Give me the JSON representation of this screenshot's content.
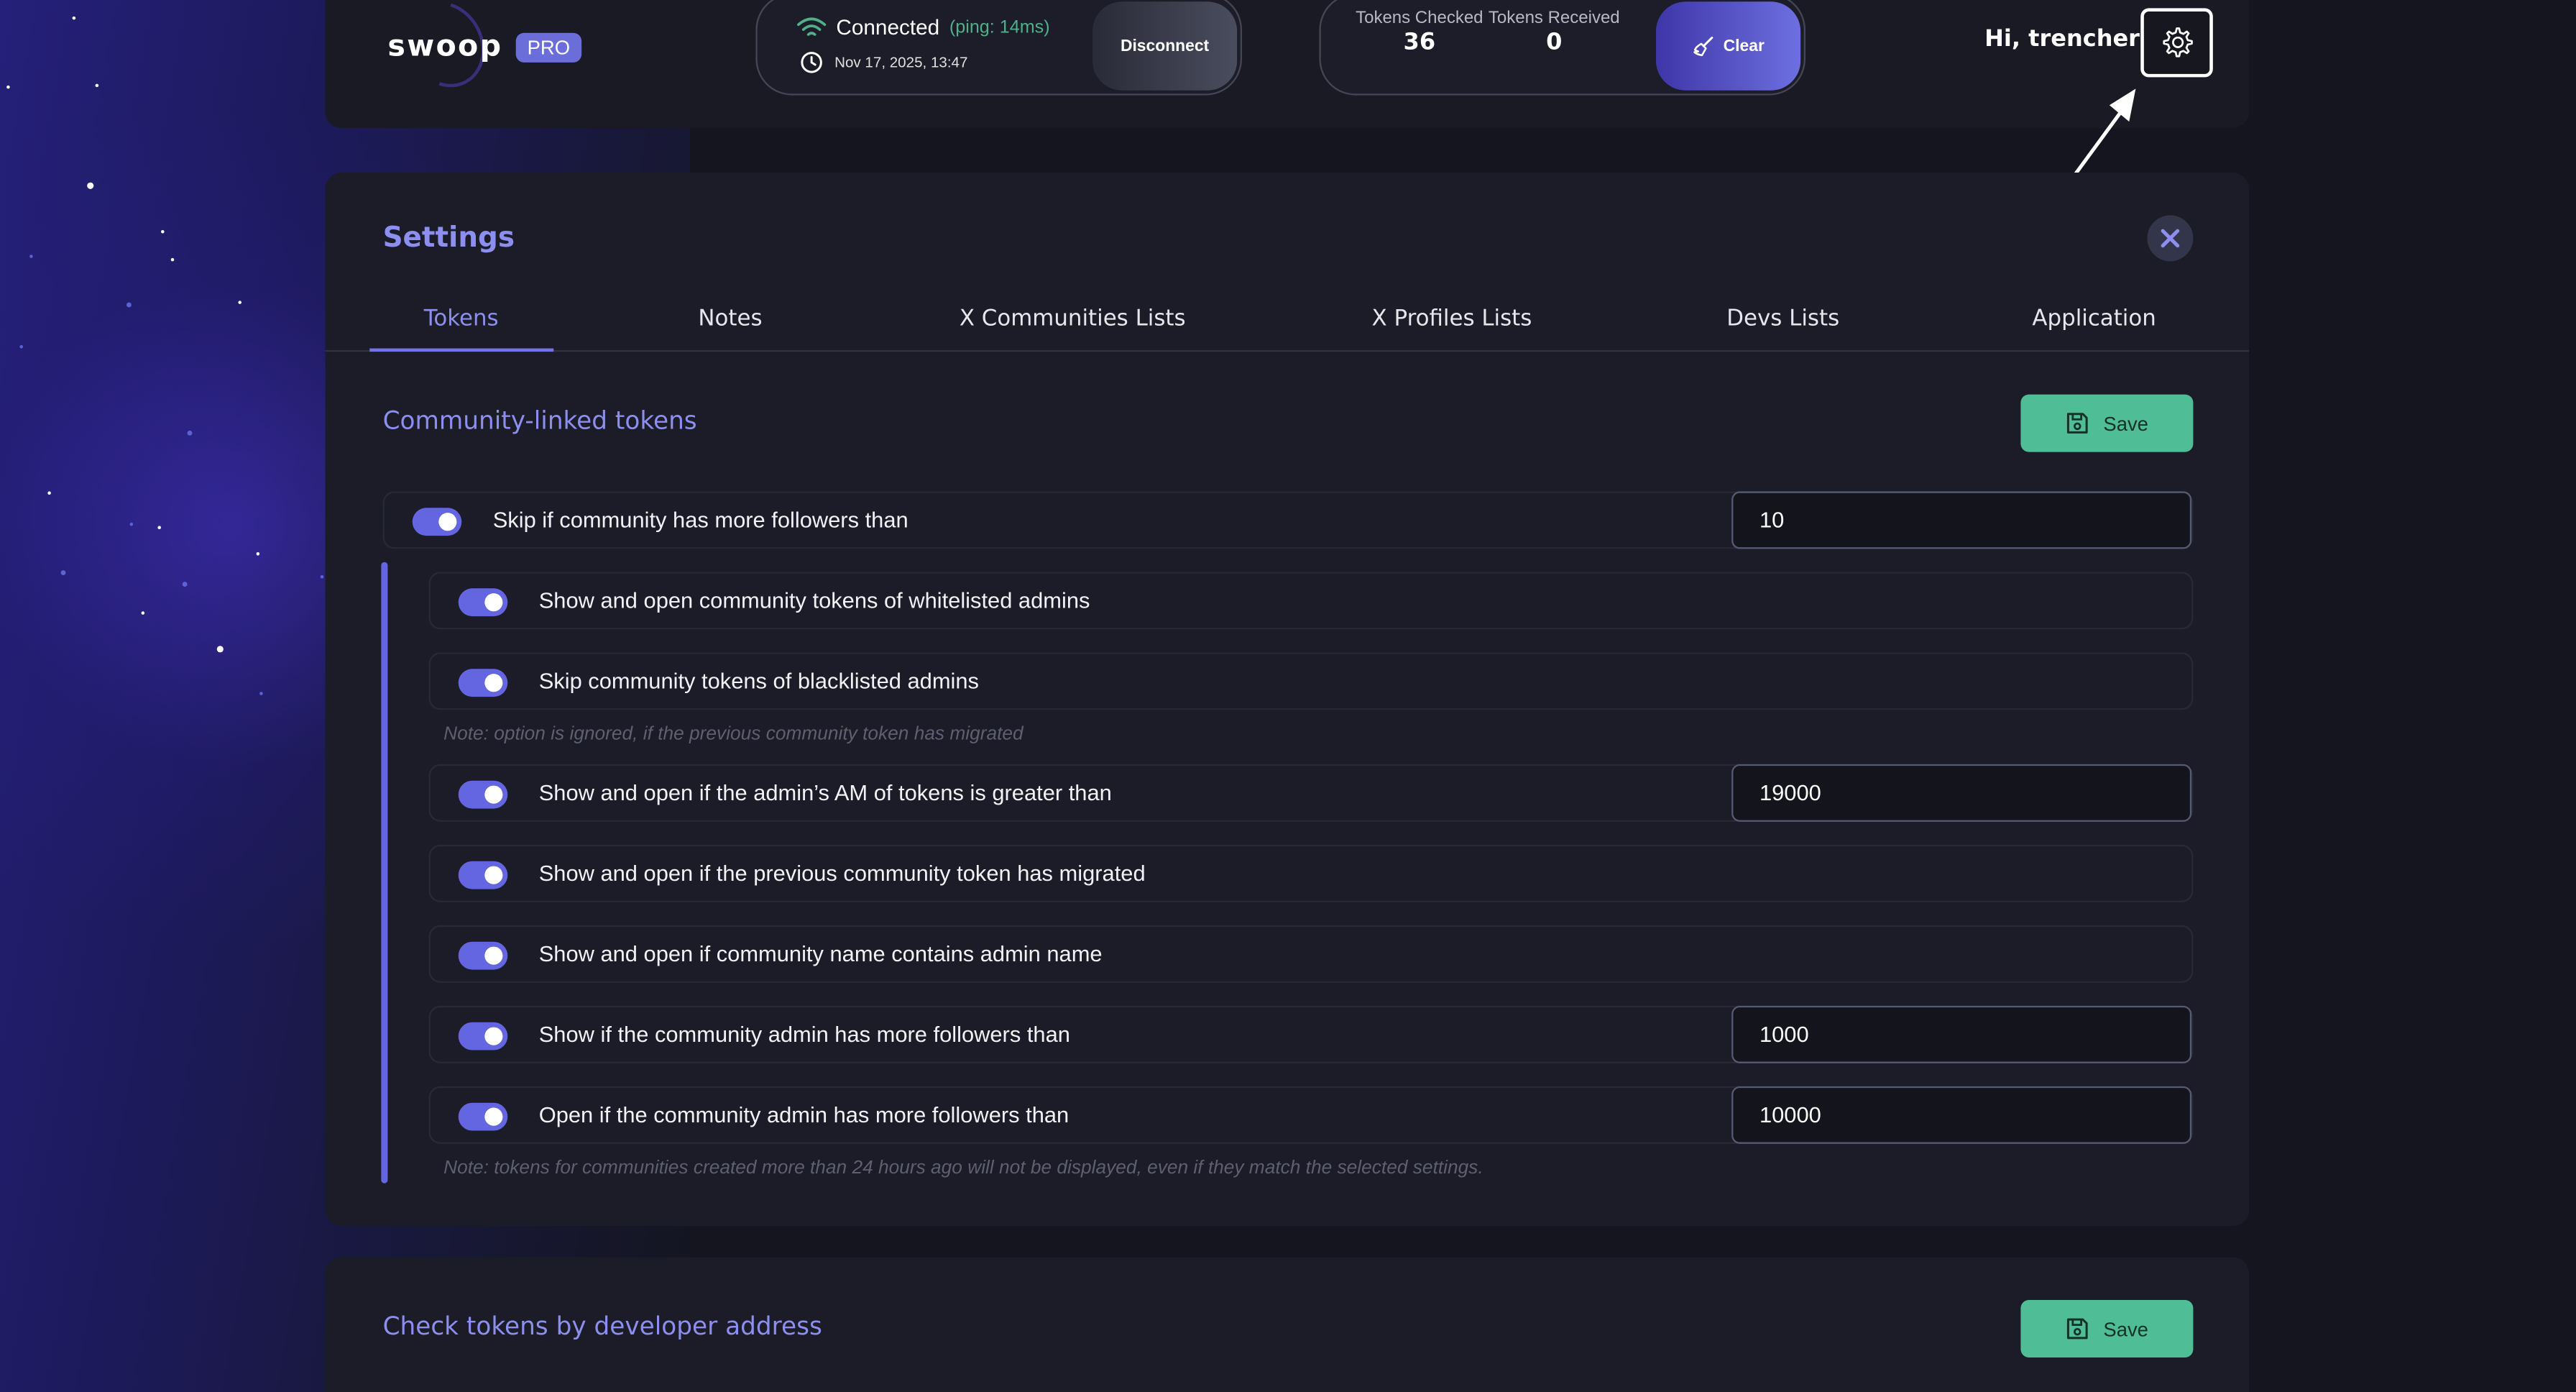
{
  "header": {
    "logo_text": "swoop",
    "badge": "PRO",
    "connection": {
      "status": "Connected",
      "ping": "(ping: 14ms)",
      "datetime": "Nov 17, 2025, 13:47",
      "disconnect_label": "Disconnect"
    },
    "counters": {
      "checked_label": "Tokens Checked",
      "checked_value": "36",
      "received_label": "Tokens Received",
      "received_value": "0",
      "clear_label": "Clear"
    },
    "greeting": "Hi, trencher!"
  },
  "settings": {
    "title": "Settings",
    "tabs": [
      {
        "label": "Tokens",
        "active": true
      },
      {
        "label": "Notes"
      },
      {
        "label": "X Communities Lists"
      },
      {
        "label": "X Profiles Lists"
      },
      {
        "label": "Devs Lists"
      },
      {
        "label": "Application"
      }
    ],
    "community_section": {
      "title": "Community-linked tokens",
      "save_label": "Save",
      "main_option": {
        "label": "Skip if community has more followers than",
        "value": "10",
        "enabled": true
      },
      "options": [
        {
          "label": "Show and open community tokens of whitelisted admins",
          "enabled": true
        },
        {
          "label": "Skip community tokens of blacklisted admins",
          "enabled": true
        },
        {
          "label": "Show and open if the admin’s AM of tokens is greater than",
          "value": "19000",
          "enabled": true
        },
        {
          "label": "Show and open if the previous community token has migrated",
          "enabled": true
        },
        {
          "label": "Show and open if community name contains admin name",
          "enabled": true
        },
        {
          "label": "Show if the community admin has more followers than",
          "value": "1000",
          "enabled": true
        },
        {
          "label": "Open if the community admin has more followers than",
          "value": "10000",
          "enabled": true
        }
      ],
      "note_migrated": "Note: option is ignored, if the previous community token has migrated",
      "note_24h": "Note: tokens for communities created more than 24 hours ago will not be displayed, even if they match the selected settings."
    },
    "developer_section": {
      "title": "Check tokens by developer address",
      "save_label": "Save"
    }
  },
  "colors": {
    "accent": "#6366e0",
    "accent_text": "#8c8ef0",
    "save_green": "#4fbe96",
    "ping_green": "#4fb08a"
  },
  "icons": [
    "wifi-icon",
    "clock-icon",
    "broom-icon",
    "gear-icon",
    "close-icon",
    "save-icon"
  ]
}
